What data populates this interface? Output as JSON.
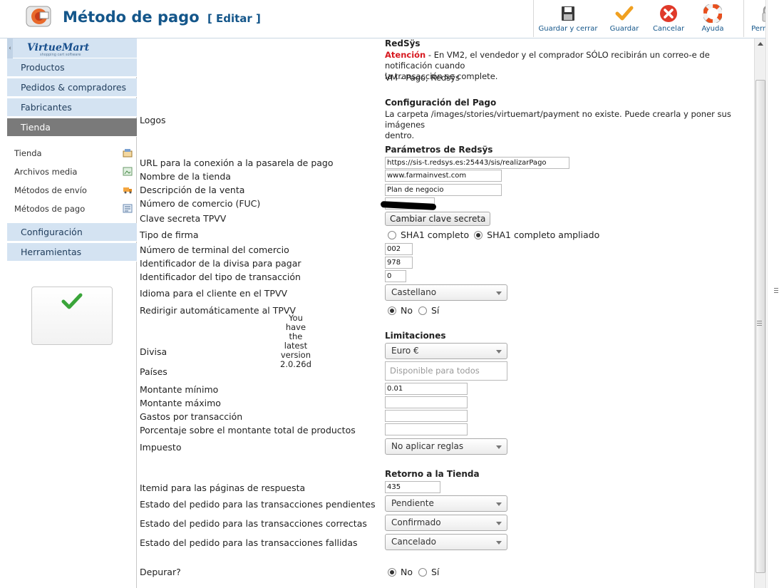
{
  "header": {
    "title": "Método de pago",
    "edit": "[ Editar ]"
  },
  "toolbar": {
    "save_close": "Guardar y cerrar",
    "save": "Guardar",
    "cancel": "Cancelar",
    "help": "Ayuda",
    "permissions": "Permisos"
  },
  "sidebar": {
    "logo": "VirtueMart",
    "logo_sub": "shopping cart software",
    "menu": [
      "Productos",
      "Pedidos & compradores",
      "Fabricantes",
      "Tienda"
    ],
    "sub": [
      "Tienda",
      "Archivos media",
      "Métodos de envío",
      "Métodos de pago"
    ],
    "menu2": [
      "Configuración",
      "Herramientas"
    ],
    "latest_line1": "You have the latest",
    "latest_line2": "version",
    "latest_version": "2.0.26d"
  },
  "form": {
    "plugin_name": "RedSÿs",
    "attention": "Atención",
    "attention_text_1": " - En VM2, el vendedor y el comprador SÓLO recibirán un correo-e de notificación cuando",
    "attention_text_2": "la transacción se complete.",
    "plugin_desc": "VM - Pago, Redsÿs",
    "sec_config": "Configuración del Pago",
    "logos_label": "Logos",
    "logos_msg_1": "La carpeta /images/stories/virtuemart/payment no existe. Puede crearla y poner sus imágenes",
    "logos_msg_2": "dentro.",
    "sec_params": "Parámetros de Redsÿs",
    "url_label": "URL para la conexión a la pasarela de pago",
    "url_value": "https://sis-t.redsys.es:25443/sis/realizarPago",
    "shop_label": "Nombre de la tienda",
    "shop_value": "www.farmainvest.com",
    "desc_label": "Descripción de la venta",
    "desc_value": "Plan de negocio",
    "fuc_label": "Número de comercio (FUC)",
    "secret_label": "Clave secreta TPVV",
    "secret_button": "Cambiar clave secreta",
    "sig_label": "Tipo de firma",
    "sig_opt1": "SHA1 completo",
    "sig_opt2": "SHA1 completo ampliado",
    "terminal_label": "Número de terminal del comercio",
    "terminal_value": "002",
    "currency_id_label": "Identificador de la divisa para pagar",
    "currency_id_value": "978",
    "trans_type_label": "Identificador del tipo de transacción",
    "trans_type_value": "0",
    "lang_label": "Idioma para el cliente en el TPVV",
    "lang_value": "Castellano",
    "redirect_label": "Redirigir automáticamente al TPVV",
    "no": "No",
    "yes": "Sí",
    "sec_limits": "Limitaciones",
    "divisa_label": "Divisa",
    "divisa_value": "Euro €",
    "countries_label": "Países",
    "countries_placeholder": "Disponible para todos",
    "min_label": "Montante mínimo",
    "min_value": "0.01",
    "max_label": "Montante máximo",
    "fee_label": "Gastos por transacción",
    "pct_label": "Porcentaje sobre el montante total de productos",
    "tax_label": "Impuesto",
    "tax_value": "No aplicar reglas",
    "sec_return": "Retorno a la Tienda",
    "itemid_label": "Itemid para las páginas de respuesta",
    "itemid_value": "435",
    "pending_label": "Estado del pedido para las transacciones pendientes",
    "pending_value": "Pendiente",
    "ok_label": "Estado del pedido para las transacciones correctas",
    "ok_value": "Confirmado",
    "fail_label": "Estado del pedido para las transacciones fallidas",
    "fail_value": "Cancelado",
    "debug_label": "Depurar?"
  }
}
